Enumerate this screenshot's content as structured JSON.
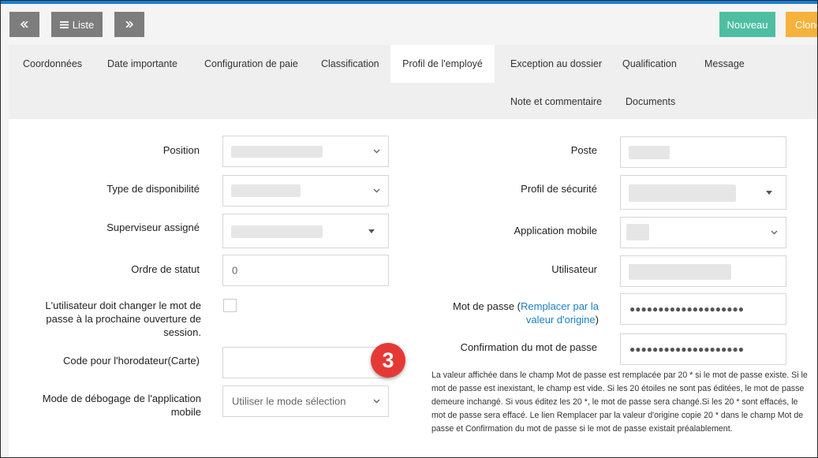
{
  "toolbar": {
    "prev_icon": "double-chevron-left-icon",
    "list_label": "Liste",
    "list_icon": "hamburger-icon",
    "next_icon": "double-chevron-right-icon",
    "new_label": "Nouveau",
    "clone_label": "Clone"
  },
  "tabs": [
    {
      "label": "Coordonnées"
    },
    {
      "label": "Date importante"
    },
    {
      "label": "Configuration de paie"
    },
    {
      "label": "Classification"
    },
    {
      "label": "Profil de l'employé",
      "active": true
    },
    {
      "label": "Exception au dossier"
    },
    {
      "label": "Qualification"
    },
    {
      "label": "Message"
    },
    {
      "label": "Note et commentaire"
    },
    {
      "label": "Documents"
    }
  ],
  "form": {
    "left": {
      "position_label": "Position",
      "availability_label": "Type de disponibilité",
      "supervisor_label": "Superviseur assigné",
      "status_order_label": "Ordre de statut",
      "status_order_value": "0",
      "must_change_pw_label": "L'utilisateur doit changer le mot de passe à la prochaine ouverture de session.",
      "punch_code_label": "Code pour l'horodateur(Carte)",
      "debug_mode_label": "Mode de débogage de l'application mobile",
      "debug_mode_value": "Utiliser le mode sélection"
    },
    "right": {
      "poste_label": "Poste",
      "security_profile_label": "Profil de sécurité",
      "mobile_app_label": "Application mobile",
      "user_label": "Utilisateur",
      "password_label_prefix": "Mot de passe (",
      "password_link": "Remplacer par la valeur d'origine",
      "password_label_suffix": ")",
      "password_value": "●●●●●●●●●●●●●●●●●●●●",
      "confirm_password_label": "Confirmation du mot de passe",
      "confirm_password_value": "●●●●●●●●●●●●●●●●●●●●",
      "help_text": "La valeur affichée dans le champ Mot de passe est remplacée par 20 * si le mot de passe existe. Si le mot de passe est inexistant, le champ est vide. Si les 20 étoiles ne sont pas éditées, le mot de passe demeure inchangé. Si vous éditez les 20 *, le mot de passe sera changé.Si les 20 * sont effacés, le mot de passe sera effacé. Le lien Remplacer par la valeur d'origine copie 20 * dans le champ Mot de passe et Confirmation du mot de passe si le mot de passe existait préalablement."
    }
  },
  "callout": {
    "number": "3"
  },
  "colors": {
    "accent_blue": "#1c7fd6",
    "new_button": "#4dbfa0",
    "clone_button": "#f6b23c",
    "badge": "#e53935"
  }
}
